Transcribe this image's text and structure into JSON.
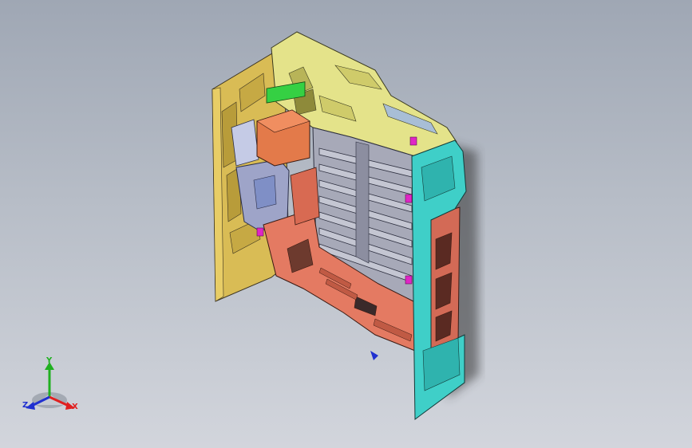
{
  "triad": {
    "x_label": "X",
    "y_label": "Y",
    "z_label": "Z"
  },
  "colors": {
    "background_top": "#9fa7b4",
    "background_bottom": "#d2d5dc",
    "frame_yellow": "#d9bc55",
    "roof_yellow": "#e4e38a",
    "floor_salmon": "#e47a62",
    "box_orange": "#e37a4a",
    "display_green": "#35d043",
    "panel_grey": "#9ea4c8",
    "panel_blue": "#7f8fc6",
    "rail_cyan": "#3fcfc8",
    "accent_magenta": "#e026c6",
    "x_axis": "#e02020",
    "y_axis": "#20b020",
    "z_axis": "#2030d0"
  },
  "model": {
    "icon": "sheet-metal-assembly"
  }
}
